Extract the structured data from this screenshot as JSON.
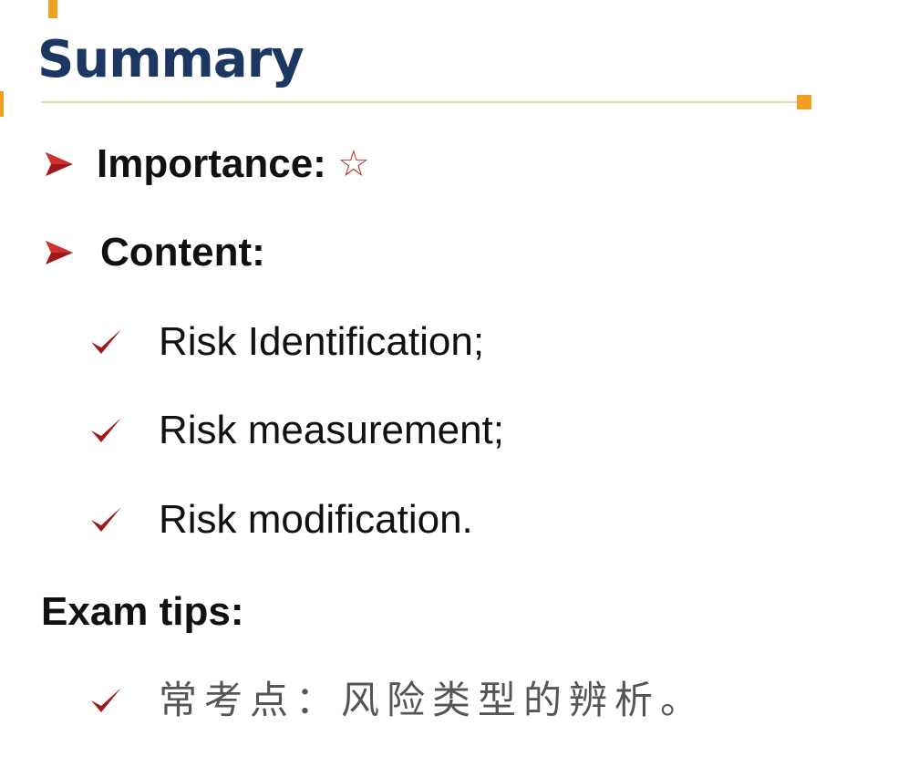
{
  "title": "Summary",
  "importance": {
    "label": "Importance:",
    "star": "☆"
  },
  "content": {
    "label": "Content:",
    "items": [
      "Risk Identification;",
      "Risk measurement;",
      "Risk modification."
    ]
  },
  "exam_tips": {
    "label": "Exam tips:",
    "items": [
      "常考点：风险类型的辨析。"
    ]
  },
  "colors": {
    "title": "#1b3762",
    "accent": "#f0a020",
    "bullet": "#a01818"
  },
  "icons": {
    "arrow_bullet": "arrow-bullet-icon",
    "check_bullet": "check-icon",
    "star": "star-icon"
  }
}
